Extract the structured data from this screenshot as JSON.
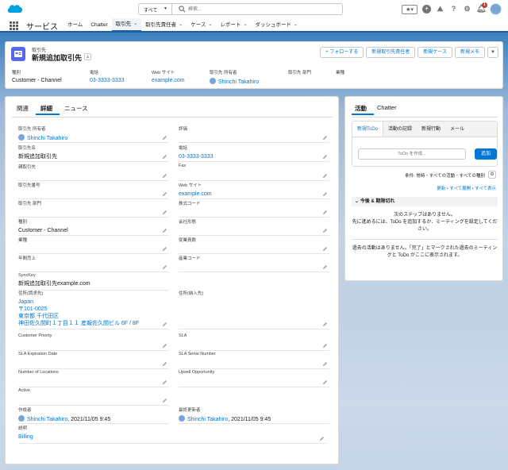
{
  "header": {
    "scope_label": "すべて",
    "search_placeholder": "検索...",
    "notification_count": "1",
    "brand_color": "#0176d3"
  },
  "nav": {
    "app_name": "サービス",
    "items": [
      {
        "label": "ホーム",
        "has_menu": false
      },
      {
        "label": "Chatter",
        "has_menu": false
      },
      {
        "label": "取引先",
        "has_menu": true,
        "active": true
      },
      {
        "label": "取引先責任者",
        "has_menu": true
      },
      {
        "label": "ケース",
        "has_menu": true
      },
      {
        "label": "レポート",
        "has_menu": true
      },
      {
        "label": "ダッシュボード",
        "has_menu": true
      }
    ]
  },
  "record": {
    "object_type": "取引先",
    "title": "新規追加取引先",
    "actions": {
      "follow": "+ フォローする",
      "new_contact": "新規取引先責任者",
      "new_case": "新規ケース",
      "new_note": "新規メモ"
    },
    "highlights": [
      {
        "label": "種別",
        "value": "Customer - Channel",
        "link": false
      },
      {
        "label": "電話",
        "value": "03-3333-3333",
        "link": true
      },
      {
        "label": "Web サイト",
        "value": "example.com",
        "link": true
      },
      {
        "label": "取引先 所有者",
        "value": "Shinchi Takahiro",
        "link": true
      },
      {
        "label": "取引先 部門",
        "value": "",
        "link": false
      },
      {
        "label": "業種",
        "value": "",
        "link": false
      }
    ]
  },
  "detail": {
    "tabs": [
      "関連",
      "詳細",
      "ニュース"
    ],
    "active_tab": "詳細",
    "fields": {
      "owner": {
        "label": "取引先 所有者",
        "value": "Shinchi Takahiro"
      },
      "rating": {
        "label": "評価",
        "value": ""
      },
      "name": {
        "label": "取引先名",
        "value": "新規追加取引先"
      },
      "phone": {
        "label": "電話",
        "value": "03-3333-3333"
      },
      "parent": {
        "label": "親取引先",
        "value": ""
      },
      "fax": {
        "label": "Fax",
        "value": ""
      },
      "number": {
        "label": "取引先番号",
        "value": ""
      },
      "website": {
        "label": "Web サイト",
        "value": "example.com"
      },
      "site": {
        "label": "取引先 部門",
        "value": ""
      },
      "ticker": {
        "label": "株式コード",
        "value": ""
      },
      "type": {
        "label": "種別",
        "value": "Customer - Channel"
      },
      "ownership": {
        "label": "会社形態",
        "value": ""
      },
      "industry": {
        "label": "業種",
        "value": ""
      },
      "employees": {
        "label": "従業員数",
        "value": ""
      },
      "revenue": {
        "label": "年間売上",
        "value": ""
      },
      "sic": {
        "label": "産業コード",
        "value": ""
      },
      "synckey": {
        "label": "SyncKey",
        "value": "新規追加取引先example.com"
      },
      "billing": {
        "label": "住所(請求先)",
        "lines": [
          "Japan",
          "〒101-0025",
          "東京都 千代田区",
          "神田佐久間町１丁目１１ 産報佐久間ビル 6F / 8F"
        ]
      },
      "shipping": {
        "label": "住所(納入先)",
        "value": ""
      },
      "priority": {
        "label": "Customer Priority",
        "value": ""
      },
      "sla": {
        "label": "SLA",
        "value": ""
      },
      "sla_exp": {
        "label": "SLA Expiration Date",
        "value": ""
      },
      "sla_serial": {
        "label": "SLA Serial Number",
        "value": ""
      },
      "locations": {
        "label": "Number of Locations",
        "value": ""
      },
      "upsell": {
        "label": "Upsell Opportunity",
        "value": ""
      },
      "active": {
        "label": "Active",
        "value": ""
      },
      "created": {
        "label": "作成者",
        "user": "Shinchi Takahiro",
        "date": ", 2021/11/05 9:45"
      },
      "modified": {
        "label": "最終更新者",
        "user": "Shinchi Takahiro",
        "date": ", 2021/11/05 9:45"
      },
      "description": {
        "label": "説明",
        "value": "Billing"
      }
    }
  },
  "activity": {
    "tabs": [
      "活動",
      "Chatter"
    ],
    "compose_tabs": [
      "新規ToDo",
      "活動の記録",
      "新規行動",
      "メール"
    ],
    "todo_placeholder": "ToDo を作成...",
    "add_label": "追加",
    "filters": "条件: 常時・すべての活動・すべての種別",
    "links": "更新 • すべて展開 • すべて表示",
    "upcoming_label": "今後 & 期限切れ",
    "no_next_steps": "次のステップはありません。",
    "no_next_steps_hint": "先に進めるには、ToDo を追加するか、ミーティングを設定してください。",
    "no_past": "過去の活動はありません。「完了」とマークされた過去のミーティングと ToDo がここに表示されます。"
  }
}
